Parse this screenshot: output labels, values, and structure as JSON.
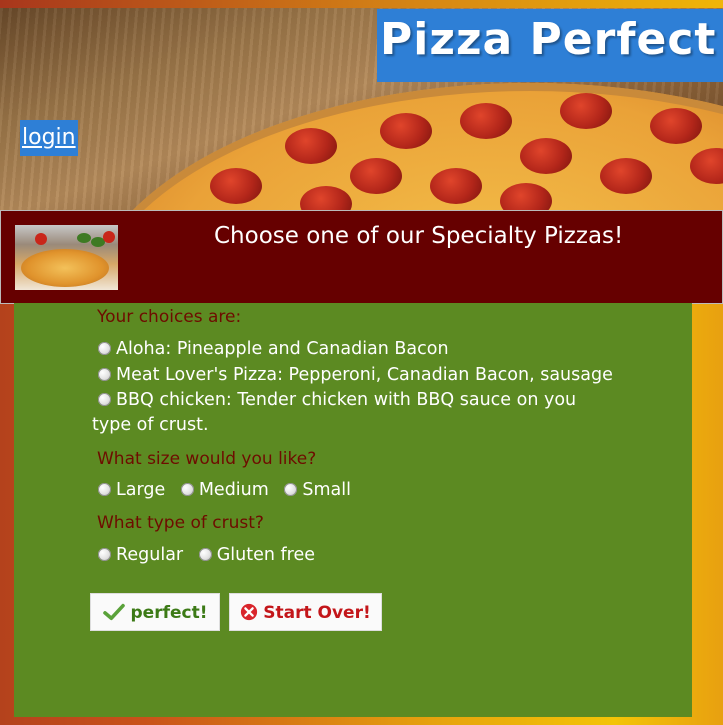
{
  "header": {
    "title": "Pizza Perfect",
    "login_label": "login"
  },
  "banner": {
    "title": "Choose one of our Specialty Pizzas!"
  },
  "form": {
    "choices_heading": "Your choices are:",
    "pizza_options": [
      "Aloha: Pineapple and Canadian Bacon",
      "Meat Lover's Pizza: Pepperoni, Canadian Bacon, sausage",
      "BBQ chicken: Tender chicken with BBQ sauce on you",
      "type of crust."
    ],
    "size_heading": "What size would you like?",
    "size_options": [
      "Large",
      "Medium",
      "Small"
    ],
    "crust_heading": "What type of crust?",
    "crust_options": [
      "Regular",
      "Gluten free"
    ],
    "submit_label": "perfect!",
    "reset_label": "Start Over!"
  },
  "colors": {
    "panel_green": "#5c8a22",
    "banner_maroon": "#660000",
    "title_blue": "#2e7fd6",
    "heading_text": "#6e0c00"
  }
}
